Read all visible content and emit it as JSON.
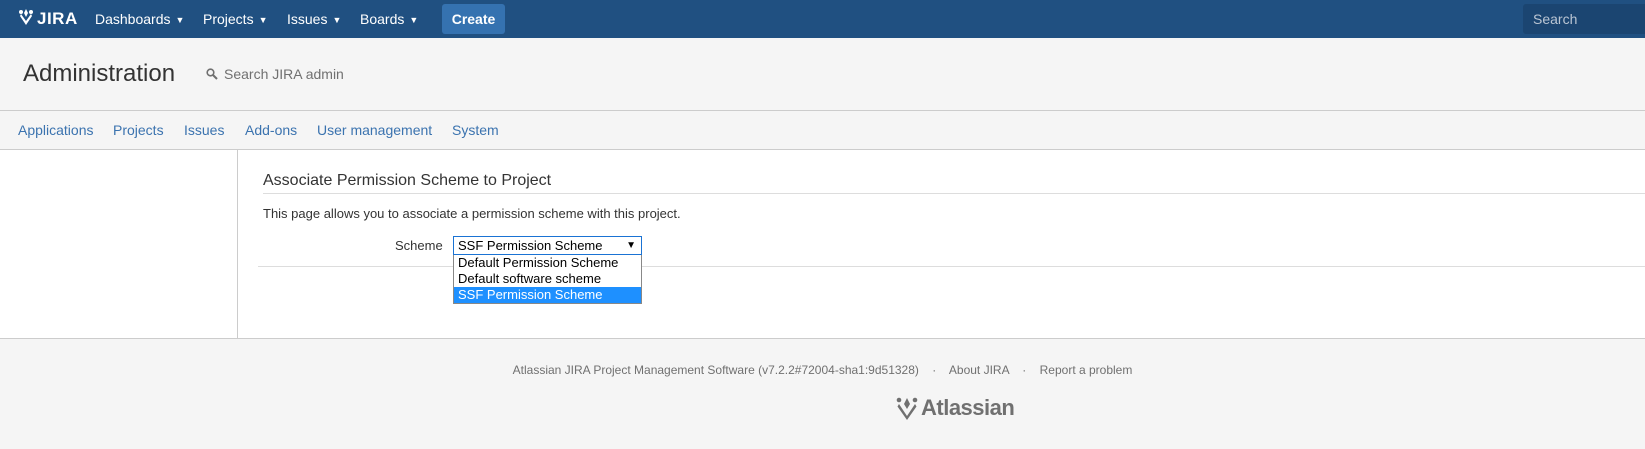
{
  "topbar": {
    "logo_text": "JIRA",
    "nav": [
      "Dashboards",
      "Projects",
      "Issues",
      "Boards"
    ],
    "create_label": "Create",
    "search_placeholder": "Search"
  },
  "admin": {
    "title": "Administration",
    "search_placeholder": "Search JIRA admin",
    "tabs": [
      "Applications",
      "Projects",
      "Issues",
      "Add-ons",
      "User management",
      "System"
    ]
  },
  "form": {
    "title": "Associate Permission Scheme to Project",
    "description": "This page allows you to associate a permission scheme with this project.",
    "scheme_label": "Scheme",
    "selected_value": "SSF Permission Scheme",
    "options": [
      "Default Permission Scheme",
      "Default software scheme",
      "SSF Permission Scheme"
    ]
  },
  "footer": {
    "version_text": "Atlassian JIRA Project Management Software (v7.2.2#72004-sha1:9d51328)",
    "separator": "·",
    "about_link": "About JIRA",
    "report_link": "Report a problem",
    "logo_text": "Atlassian"
  },
  "colors": {
    "topbar": "#205081",
    "create_button": "#3572b0",
    "link": "#3b73af",
    "selected_option": "#1e90ff"
  }
}
